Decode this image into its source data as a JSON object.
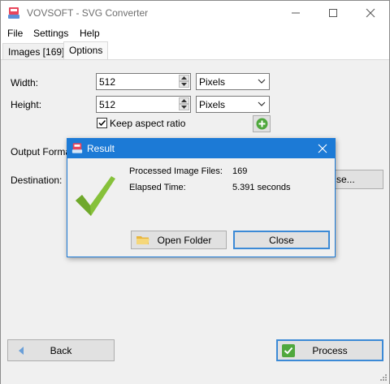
{
  "window": {
    "title": "VOVSOFT - SVG Converter"
  },
  "menu": {
    "file": "File",
    "settings": "Settings",
    "help": "Help"
  },
  "tabs": {
    "images": "Images [169]",
    "options": "Options"
  },
  "options": {
    "width_label": "Width:",
    "width_value": "512",
    "width_unit": "Pixels",
    "height_label": "Height:",
    "height_value": "512",
    "height_unit": "Pixels",
    "keep_aspect_label": "Keep aspect ratio",
    "keep_aspect_checked": true,
    "output_format_label": "Output Forma",
    "destination_label": "Destination:",
    "browse_label": "se..."
  },
  "dialog": {
    "title": "Result",
    "processed_label": "Processed Image Files:",
    "processed_value": "169",
    "elapsed_label": "Elapsed Time:",
    "elapsed_value": "5.391 seconds",
    "open_folder_label": "Open Folder",
    "close_label": "Close"
  },
  "footer": {
    "back_label": "Back",
    "process_label": "Process"
  },
  "colors": {
    "accent": "#1c7ad6",
    "check_green": "#7cb82f",
    "folder_yellow": "#f2c94c"
  },
  "icons": [
    "app-icon",
    "minimize-icon",
    "maximize-icon",
    "close-icon",
    "add-icon",
    "success-checkmark-icon",
    "folder-icon",
    "back-arrow-icon",
    "process-check-icon"
  ]
}
